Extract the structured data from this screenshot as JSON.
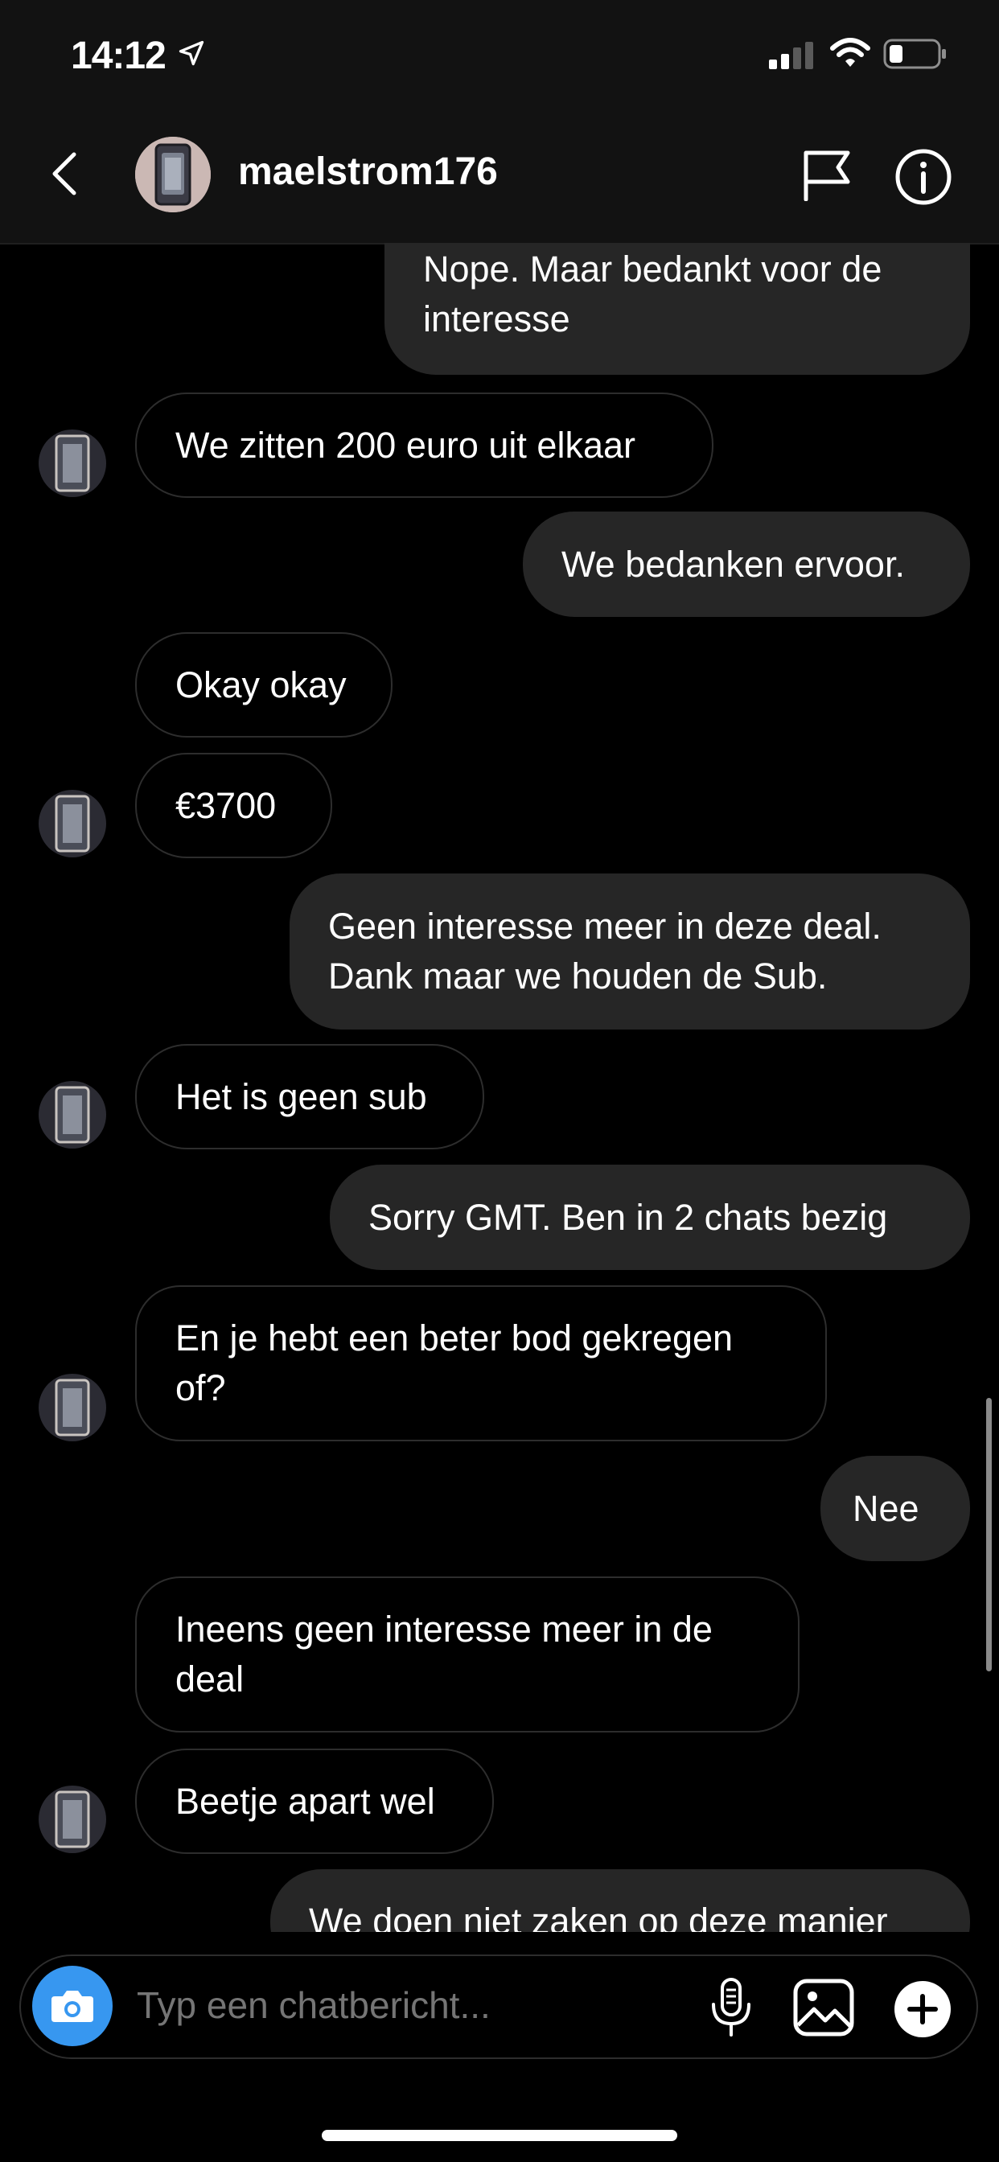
{
  "status_bar": {
    "time": "14:12"
  },
  "header": {
    "username": "maelstrom176"
  },
  "messages": [
    {
      "text": "Nope. Maar bedankt voor de\ninteresse",
      "from": "me"
    },
    {
      "text": "We zitten 200 euro uit elkaar",
      "from": "them"
    },
    {
      "text": "We bedanken ervoor.",
      "from": "me"
    },
    {
      "text": "Okay okay",
      "from": "them"
    },
    {
      "text": "€3700",
      "from": "them"
    },
    {
      "text": "Geen interesse meer in deze deal.\nDank maar we houden de Sub.",
      "from": "me"
    },
    {
      "text": "Het is geen sub",
      "from": "them"
    },
    {
      "text": "Sorry GMT. Ben in 2 chats bezig",
      "from": "me"
    },
    {
      "text": "En je hebt een beter bod gekregen\nof?",
      "from": "them"
    },
    {
      "text": "Nee",
      "from": "me"
    },
    {
      "text": "Ineens geen interesse meer in de\ndeal",
      "from": "them"
    },
    {
      "text": "Beetje apart wel",
      "from": "them"
    },
    {
      "text": "We doen niet zaken op deze manier",
      "from": "me"
    }
  ],
  "composer": {
    "placeholder": "Typ een chatbericht..."
  },
  "icons": {
    "back": "chevron-left-icon",
    "flag": "flag-icon",
    "info": "info-icon",
    "camera": "camera-icon",
    "mic": "microphone-icon",
    "gallery": "gallery-icon",
    "add": "plus-icon"
  },
  "colors": {
    "accent": "#3797f0",
    "outgoing_bubble": "#262626",
    "background": "#000000"
  }
}
